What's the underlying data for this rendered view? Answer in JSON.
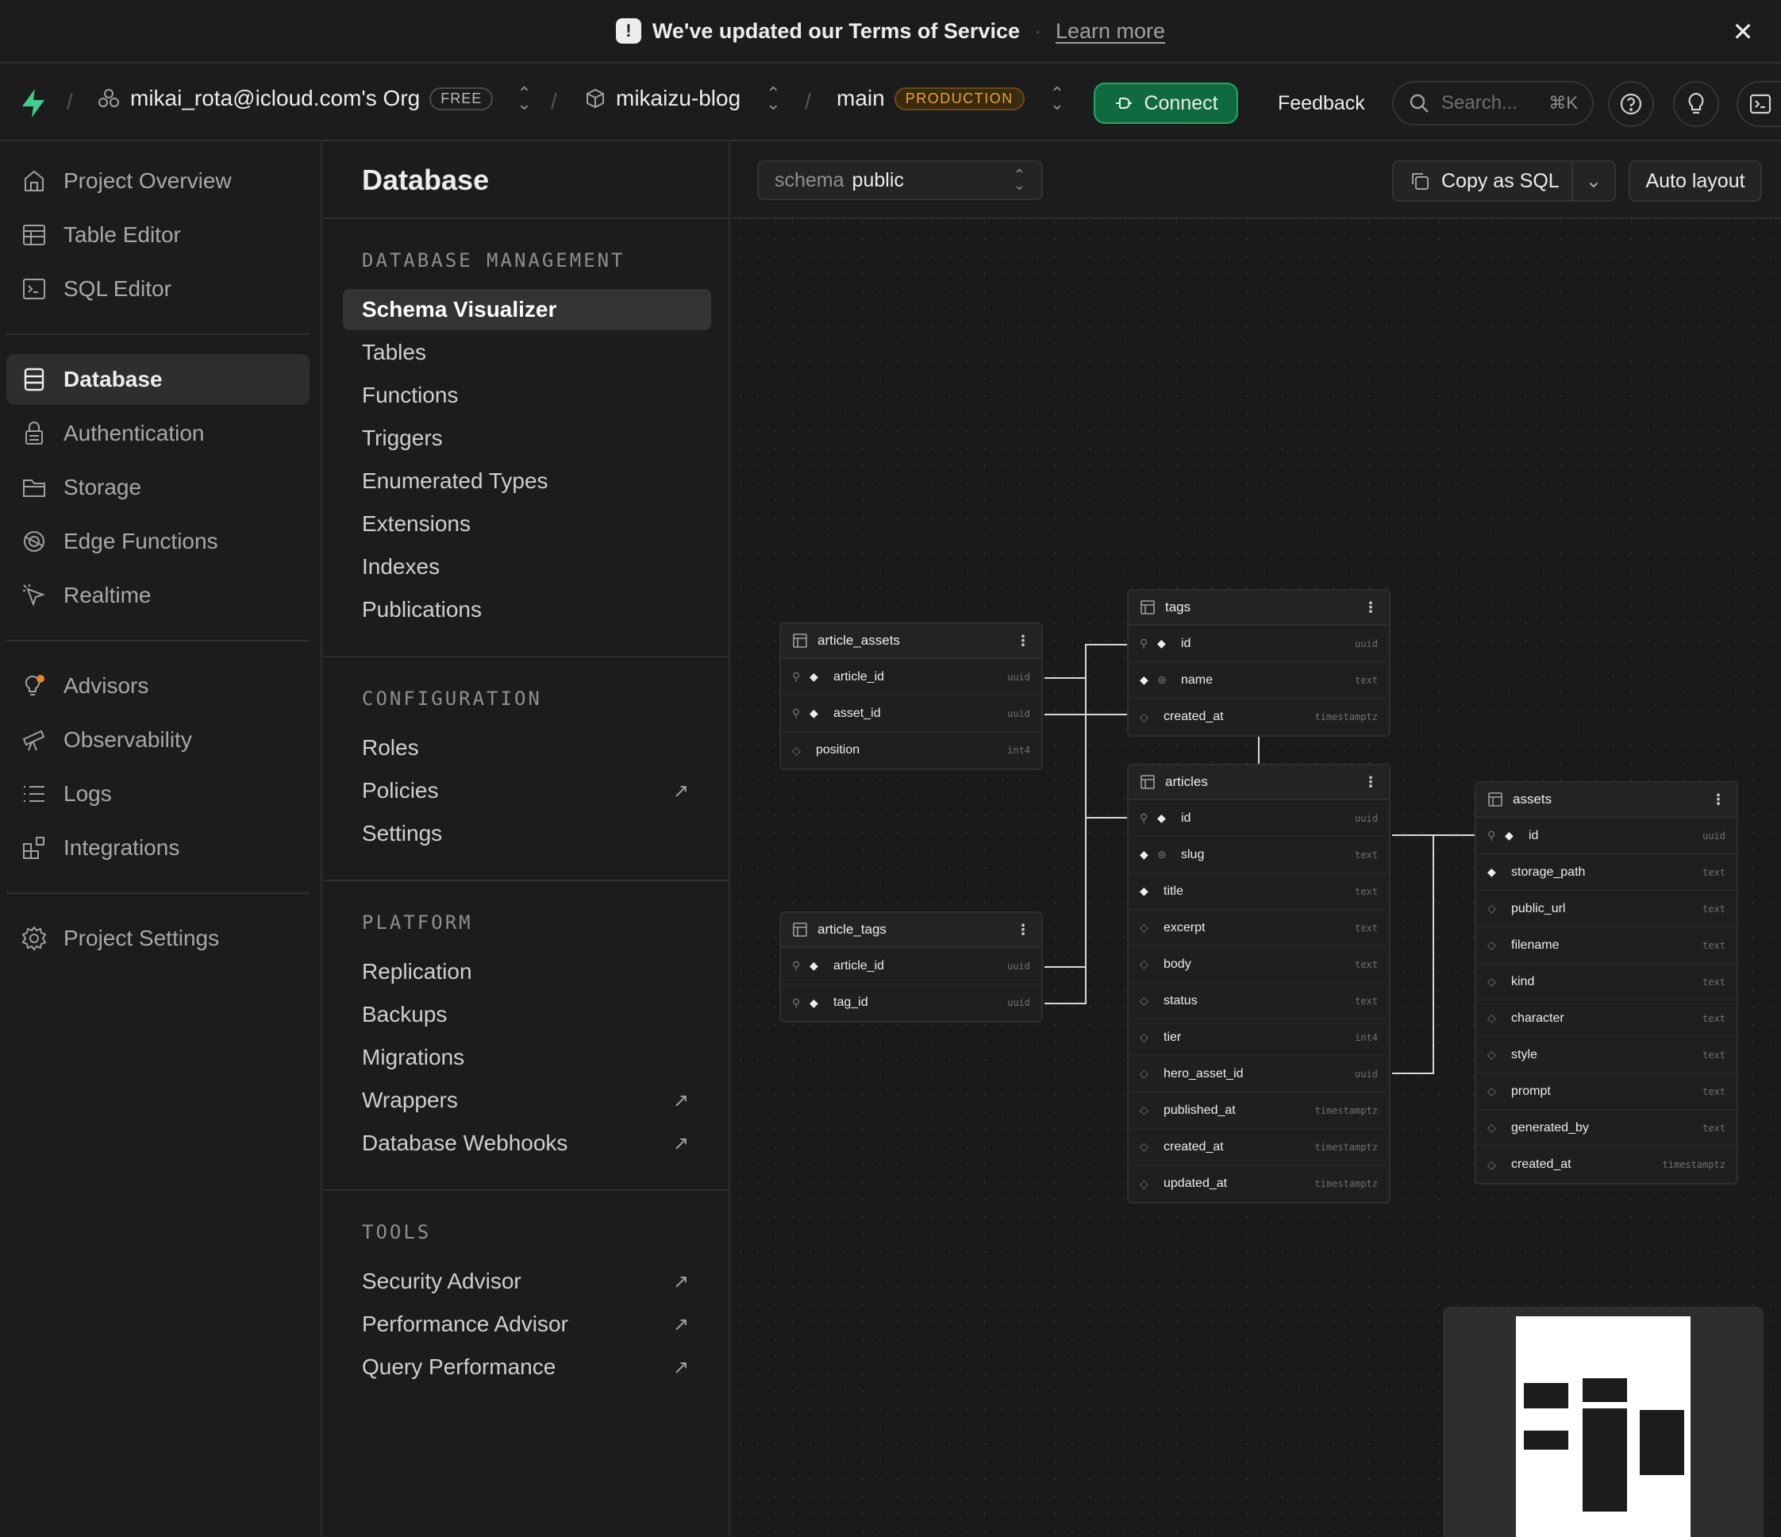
{
  "banner": {
    "text": "We've updated our Terms of Service",
    "link": "Learn more"
  },
  "topbar": {
    "org": "mikai_rota@icloud.com's Org",
    "org_badge": "FREE",
    "project": "mikaizu-blog",
    "branch": "main",
    "branch_badge": "PRODUCTION",
    "connect": "Connect",
    "feedback": "Feedback",
    "search_placeholder": "Search...",
    "search_shortcut": "⌘K"
  },
  "leftnav": {
    "items": [
      {
        "label": "Project Overview",
        "icon": "home-icon"
      },
      {
        "label": "Table Editor",
        "icon": "table-icon"
      },
      {
        "label": "SQL Editor",
        "icon": "terminal-icon"
      },
      {
        "label": "Database",
        "icon": "database-icon"
      },
      {
        "label": "Authentication",
        "icon": "lock-icon"
      },
      {
        "label": "Storage",
        "icon": "folder-icon"
      },
      {
        "label": "Edge Functions",
        "icon": "globe-icon"
      },
      {
        "label": "Realtime",
        "icon": "cursor-icon"
      },
      {
        "label": "Advisors",
        "icon": "lightbulb-icon"
      },
      {
        "label": "Observability",
        "icon": "telescope-icon"
      },
      {
        "label": "Logs",
        "icon": "list-icon"
      },
      {
        "label": "Integrations",
        "icon": "blocks-icon"
      },
      {
        "label": "Project Settings",
        "icon": "gear-icon"
      }
    ]
  },
  "dbmenu": {
    "title": "Database",
    "sections": [
      {
        "title": "DATABASE MANAGEMENT",
        "items": [
          "Schema Visualizer",
          "Tables",
          "Functions",
          "Triggers",
          "Enumerated Types",
          "Extensions",
          "Indexes",
          "Publications"
        ]
      },
      {
        "title": "CONFIGURATION",
        "items": [
          "Roles",
          "Policies",
          "Settings"
        ]
      },
      {
        "title": "PLATFORM",
        "items": [
          "Replication",
          "Backups",
          "Migrations",
          "Wrappers",
          "Database Webhooks"
        ]
      },
      {
        "title": "TOOLS",
        "items": [
          "Security Advisor",
          "Performance Advisor",
          "Query Performance"
        ]
      }
    ]
  },
  "canvas": {
    "schema_label": "schema",
    "schema_value": "public",
    "copy_sql": "Copy as SQL",
    "auto_layout": "Auto layout"
  },
  "tables": {
    "article_assets": {
      "name": "article_assets",
      "columns": [
        {
          "name": "article_id",
          "type": "uuid"
        },
        {
          "name": "asset_id",
          "type": "uuid"
        },
        {
          "name": "position",
          "type": "int4"
        }
      ]
    },
    "article_tags": {
      "name": "article_tags",
      "columns": [
        {
          "name": "article_id",
          "type": "uuid"
        },
        {
          "name": "tag_id",
          "type": "uuid"
        }
      ]
    },
    "tags": {
      "name": "tags",
      "columns": [
        {
          "name": "id",
          "type": "uuid"
        },
        {
          "name": "name",
          "type": "text"
        },
        {
          "name": "created_at",
          "type": "timestamptz"
        }
      ]
    },
    "articles": {
      "name": "articles",
      "columns": [
        {
          "name": "id",
          "type": "uuid"
        },
        {
          "name": "slug",
          "type": "text"
        },
        {
          "name": "title",
          "type": "text"
        },
        {
          "name": "excerpt",
          "type": "text"
        },
        {
          "name": "body",
          "type": "text"
        },
        {
          "name": "status",
          "type": "text"
        },
        {
          "name": "tier",
          "type": "int4"
        },
        {
          "name": "hero_asset_id",
          "type": "uuid"
        },
        {
          "name": "published_at",
          "type": "timestamptz"
        },
        {
          "name": "created_at",
          "type": "timestamptz"
        },
        {
          "name": "updated_at",
          "type": "timestamptz"
        }
      ]
    },
    "assets": {
      "name": "assets",
      "columns": [
        {
          "name": "id",
          "type": "uuid"
        },
        {
          "name": "storage_path",
          "type": "text"
        },
        {
          "name": "public_url",
          "type": "text"
        },
        {
          "name": "filename",
          "type": "text"
        },
        {
          "name": "kind",
          "type": "text"
        },
        {
          "name": "character",
          "type": "text"
        },
        {
          "name": "style",
          "type": "text"
        },
        {
          "name": "prompt",
          "type": "text"
        },
        {
          "name": "generated_by",
          "type": "text"
        },
        {
          "name": "created_at",
          "type": "timestamptz"
        }
      ]
    }
  }
}
